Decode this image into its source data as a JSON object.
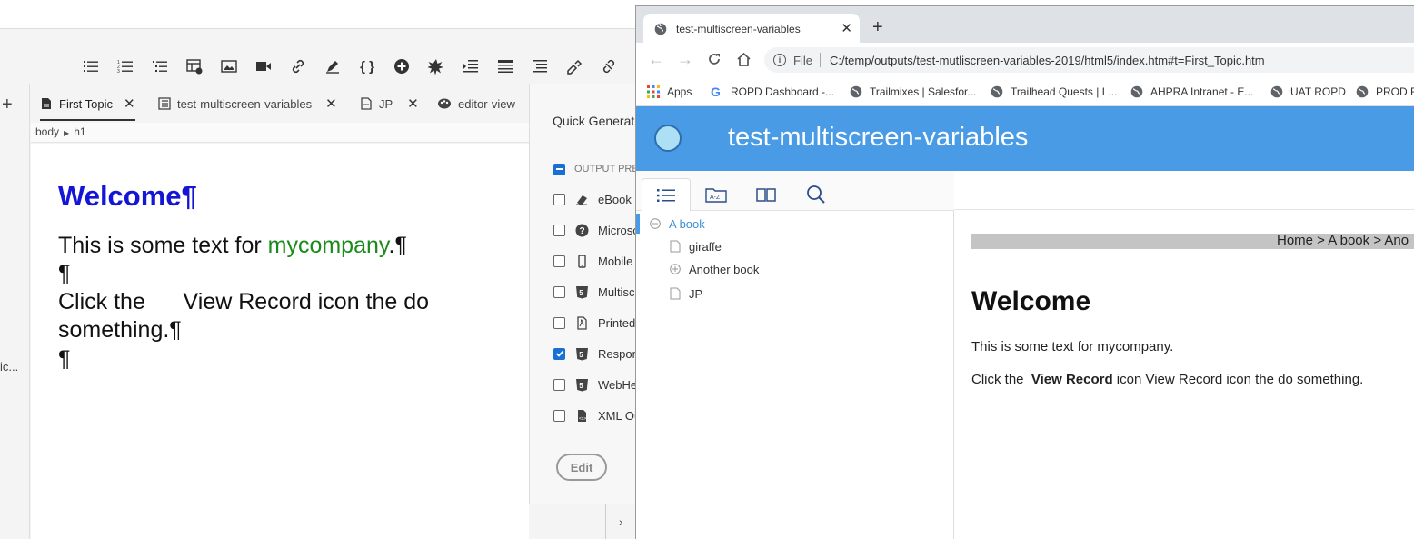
{
  "editor": {
    "tabs": [
      {
        "label": "First Topic"
      },
      {
        "label": "test-multiscreen-variables"
      },
      {
        "label": "JP"
      },
      {
        "label": "editor-view"
      }
    ],
    "left_truncated": "ic...",
    "breadcrumb": [
      "body",
      "h1"
    ],
    "document": {
      "heading": "Welcome¶",
      "line1_pre": "This is some text for ",
      "line1_var": "mycompany",
      "line1_post": ".¶",
      "pilcrow": "¶",
      "line2": "Click the      View Record icon the do",
      "line3": "something.¶"
    },
    "panel": {
      "title": "Quick Generat",
      "header_option": "OUTPUT PRE",
      "options": [
        "eBook",
        "Microso",
        "Mobile",
        "Multisc",
        "Printed",
        "Respon",
        "WebHe",
        "XML Ou"
      ],
      "checked_index": 5,
      "edit_label": "Edit"
    }
  },
  "browser": {
    "tab_title": "test-multiscreen-variables",
    "url_scheme": "File",
    "url": "C:/temp/outputs/test-mutliscreen-variables-2019/html5/index.htm#t=First_Topic.htm",
    "bookmarks": [
      "Apps",
      "ROPD Dashboard -...",
      "Trailmixes | Salesfor...",
      "Trailhead Quests | L...",
      "AHPRA Intranet  - E...",
      "UAT ROPD",
      "PROD R"
    ],
    "site_title": "test-multiscreen-variables",
    "toc": [
      {
        "label": "A book"
      },
      {
        "label": "giraffe"
      },
      {
        "label": "Another book"
      },
      {
        "label": "JP"
      }
    ],
    "breadcrumb_text": "Home > A book > Ano",
    "heading": "Welcome",
    "para1": "This is some text for mycompany.",
    "para2_pre": "Click the  ",
    "para2_bold": "View Record",
    "para2_post": " icon View Record icon the do something."
  }
}
